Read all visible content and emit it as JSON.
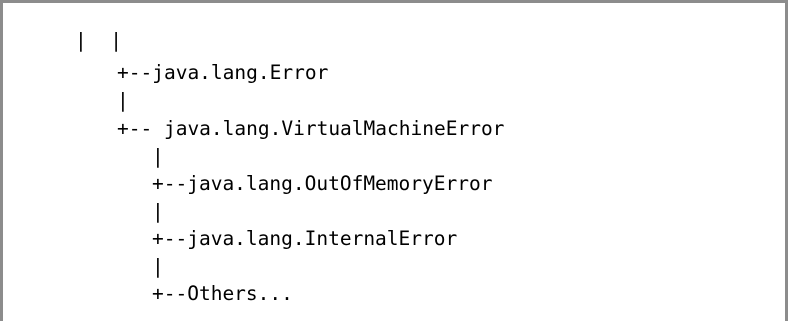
{
  "code_block": {
    "lines": [
      "|  |",
      "+--java.lang.Error",
      "|",
      "+-- java.lang.VirtualMachineError",
      "|",
      "+--java.lang.OutOfMemoryError",
      "|",
      "+--java.lang.InternalError",
      "|",
      "+--Others..."
    ]
  }
}
